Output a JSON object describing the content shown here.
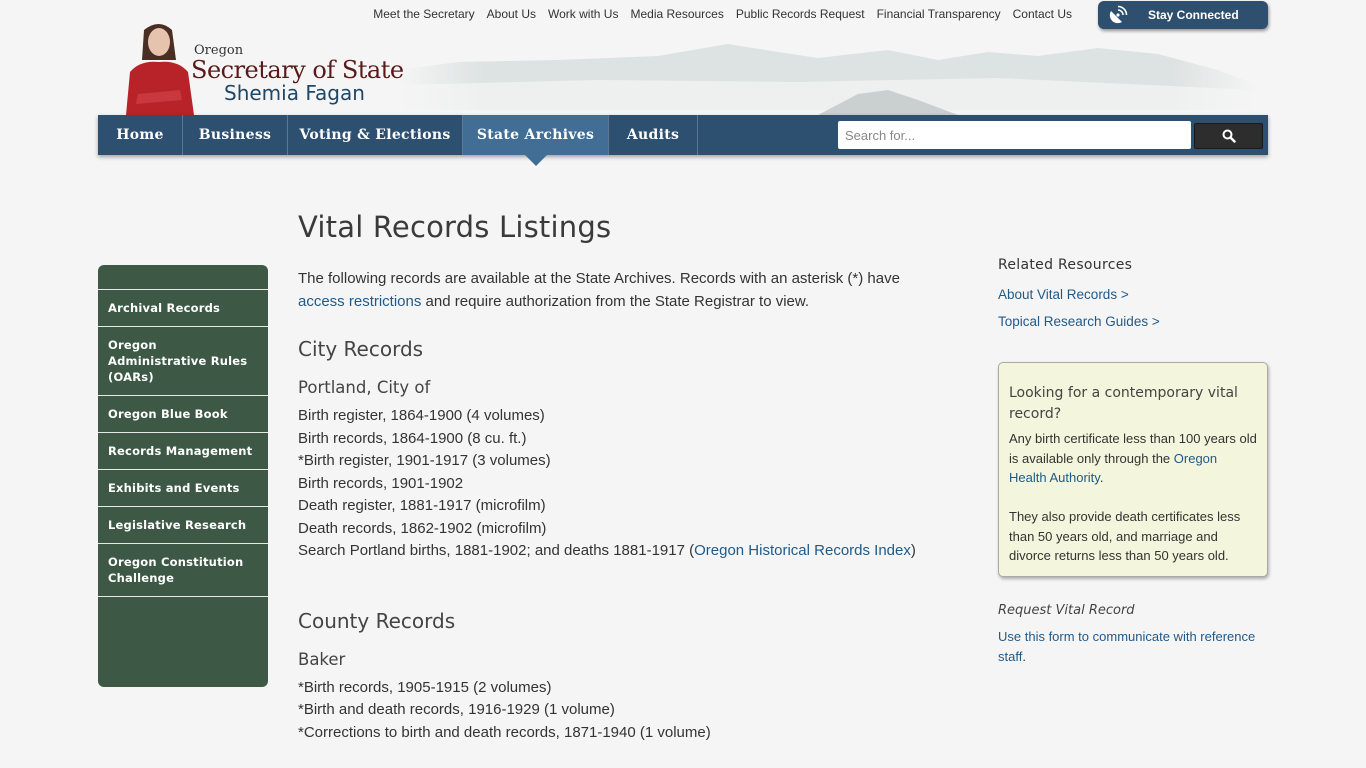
{
  "header": {
    "logo": {
      "state": "Oregon",
      "office": "Secretary of State",
      "official": "Shemia Fagan"
    },
    "utility_nav": [
      {
        "label": "Meet the Secretary"
      },
      {
        "label": "About Us"
      },
      {
        "label": "Work with Us"
      },
      {
        "label": "Media Resources"
      },
      {
        "label": "Public Records Request"
      },
      {
        "label": "Financial Transparency"
      },
      {
        "label": "Contact Us"
      }
    ],
    "stay_connected": {
      "label": "Stay Connected",
      "icon": "satellite-dish-icon"
    }
  },
  "main_nav": {
    "items": [
      {
        "label": "Home",
        "active": false
      },
      {
        "label": "Business",
        "active": false
      },
      {
        "label": "Voting & Elections",
        "active": false
      },
      {
        "label": "State Archives",
        "active": true
      },
      {
        "label": "Audits",
        "active": false
      }
    ],
    "search": {
      "placeholder": "Search for...",
      "value": "",
      "button_icon": "search-icon"
    }
  },
  "sidebar": {
    "items": [
      {
        "label": "Archival Records"
      },
      {
        "label": "Oregon Administrative Rules (OARs)"
      },
      {
        "label": "Oregon Blue Book"
      },
      {
        "label": "Records Management"
      },
      {
        "label": "Exhibits and Events"
      },
      {
        "label": "Legislative Research"
      },
      {
        "label": "Oregon Constitution Challenge"
      }
    ]
  },
  "content": {
    "title": "Vital Records Listings",
    "intro": {
      "before": " The following records are available at the State Archives. Records with an asterisk (*) have ",
      "link": "access restrictions",
      "after": " and require authorization from the State Registrar to view."
    },
    "city_section": {
      "heading": "City Records",
      "subheading": "Portland, City of",
      "records": [
        "Birth register, 1864-1900 (4 volumes)",
        "Birth records, 1864-1900 (8 cu. ft.)",
        "*Birth register, 1901-1917 (3 volumes)",
        "Birth records, 1901-1902",
        "Death register, 1881-1917 (microfilm)",
        "Death records, 1862-1902 (microfilm)"
      ],
      "search_line": {
        "before": "Search Portland births, 1881-1902; and deaths 1881-1917 (",
        "link": "Oregon Historical Records Index",
        "after": ")"
      }
    },
    "county_section": {
      "heading": "County Records",
      "subheading": "Baker",
      "records": [
        "*Birth records, 1905-1915 (2 volumes)",
        "*Birth and death records, 1916-1929 (1 volume)",
        "*Corrections to birth and death records, 1871-1940 (1 volume)"
      ]
    }
  },
  "right_column": {
    "related_title": "Related Resources",
    "related_links": [
      {
        "label": "About Vital Records >"
      },
      {
        "label": "Topical Research Guides >"
      }
    ],
    "callout": {
      "title": "Looking for a contemporary vital record?",
      "p1_before": "Any birth certificate less than 100 years old is available only through the ",
      "p1_link": "Oregon Health Authority",
      "p1_after": ".",
      "p2": "They also provide death certificates less than 50 years old, and marriage and divorce returns less than 50 years old."
    },
    "request": {
      "title": "Request Vital Record",
      "link": "Use this form to communicate with reference staff",
      "after": "."
    }
  },
  "colors": {
    "nav_bg": "#2e5070",
    "nav_active": "#426e96",
    "sidebar_bg": "#3d5946",
    "link": "#1f5a8a",
    "callout_bg": "#f3f5dc"
  }
}
